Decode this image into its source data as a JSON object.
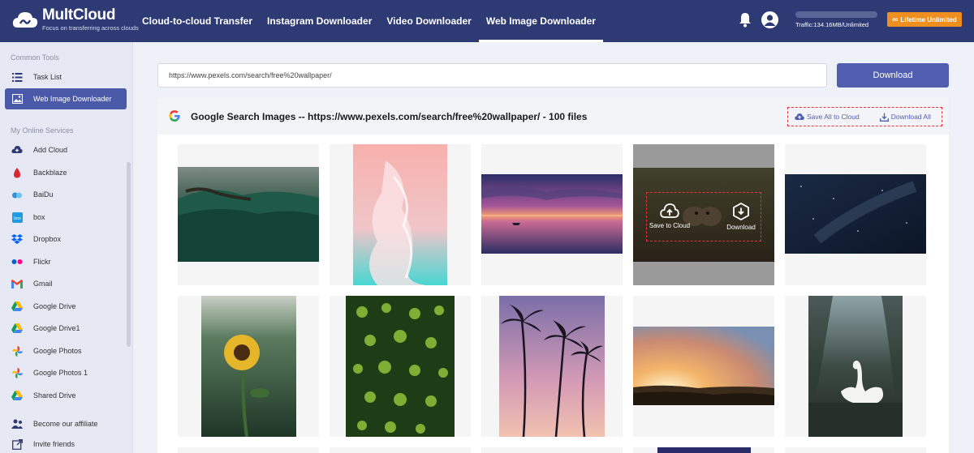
{
  "header": {
    "logo_name": "MultCloud",
    "logo_tagline": "Focus on transferring across clouds",
    "nav": [
      {
        "label": "Cloud-to-cloud Transfer"
      },
      {
        "label": "Instagram Downloader"
      },
      {
        "label": "Video Downloader"
      },
      {
        "label": "Web Image Downloader"
      }
    ],
    "traffic_text": "Traffic:134.16MB/Unlimited",
    "lifetime_label": "Lifetime Unlimited",
    "accent": "#2e3a73",
    "lifetime_color": "#ef8f1f"
  },
  "sidebar": {
    "common_heading": "Common Tools",
    "common_items": [
      {
        "label": "Task List",
        "icon": "list-icon"
      },
      {
        "label": "Web Image Downloader",
        "icon": "image-icon"
      }
    ],
    "services_heading": "My Online Services",
    "services": [
      {
        "label": "Add Cloud",
        "icon": "add-cloud-icon"
      },
      {
        "label": "Backblaze",
        "icon": "backblaze-icon"
      },
      {
        "label": "BaiDu",
        "icon": "baidu-icon"
      },
      {
        "label": "box",
        "icon": "box-icon"
      },
      {
        "label": "Dropbox",
        "icon": "dropbox-icon"
      },
      {
        "label": "Flickr",
        "icon": "flickr-icon"
      },
      {
        "label": "Gmail",
        "icon": "gmail-icon"
      },
      {
        "label": "Google Drive",
        "icon": "google-drive-icon"
      },
      {
        "label": "Google Drive1",
        "icon": "google-drive-icon"
      },
      {
        "label": "Google Photos",
        "icon": "google-photos-icon"
      },
      {
        "label": "Google Photos 1",
        "icon": "google-photos-icon"
      },
      {
        "label": "Shared Drive",
        "icon": "google-drive-icon"
      }
    ],
    "bottom_items": [
      {
        "label": "Become our affiliate",
        "icon": "affiliate-icon"
      },
      {
        "label": "Invite friends",
        "icon": "invite-icon"
      }
    ]
  },
  "main": {
    "url_value": "https://www.pexels.com/search/free%20wallpaper/",
    "download_button": "Download",
    "results_title": "Google Search Images -- https://www.pexels.com/search/free%20wallpaper/ - 100 files",
    "save_all_label": "Save All to Cloud",
    "download_all_label": "Download All",
    "hover_save_label": "Save to Cloud",
    "hover_download_label": "Download",
    "images": [
      {
        "subject": "woman-lying-in-green-field"
      },
      {
        "subject": "pink-teal-brush-strokes"
      },
      {
        "subject": "sunset-over-water"
      },
      {
        "subject": "two-birds"
      },
      {
        "subject": "starry-night-sky"
      },
      {
        "subject": "sunflower"
      },
      {
        "subject": "green-plant-aerial"
      },
      {
        "subject": "palm-trees-purple-sky"
      },
      {
        "subject": "sunrise-over-field"
      },
      {
        "subject": "white-swan"
      }
    ]
  }
}
